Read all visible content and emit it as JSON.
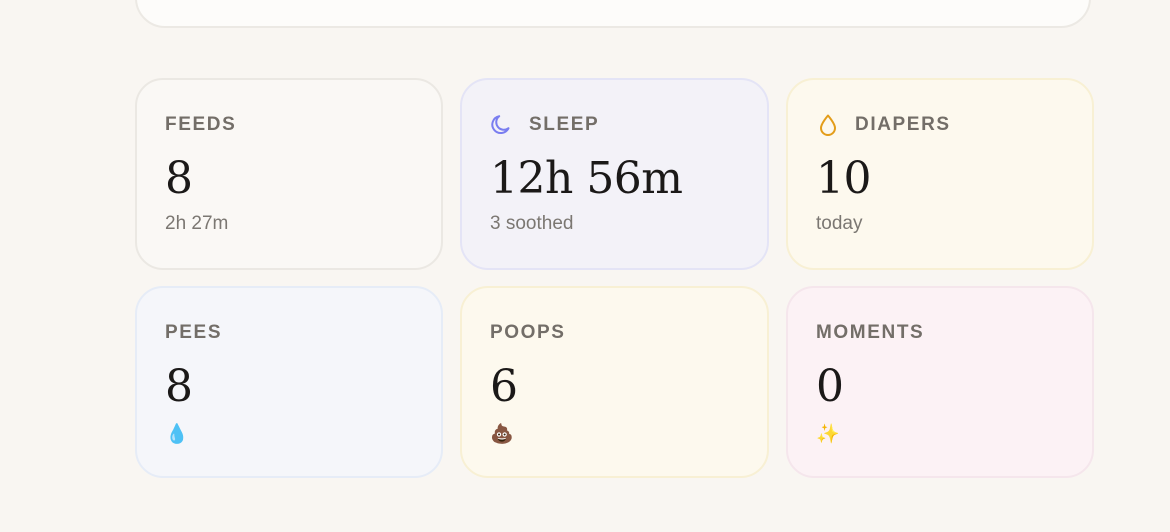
{
  "cards": {
    "feeds": {
      "label": "FEEDS",
      "value": "8",
      "sub": "2h 27m"
    },
    "sleep": {
      "label": "SLEEP",
      "value": "12h 56m",
      "sub": "3 soothed",
      "icon": "moon-icon",
      "icon_color": "#7a7ef0"
    },
    "diapers": {
      "label": "DIAPERS",
      "value": "10",
      "sub": "today",
      "icon": "drop-icon",
      "icon_color": "#e39d1a"
    },
    "pees": {
      "label": "PEES",
      "value": "8",
      "emoji": "💧"
    },
    "poops": {
      "label": "POOPS",
      "value": "6",
      "emoji": "💩"
    },
    "moments": {
      "label": "MOMENTS",
      "value": "0",
      "emoji": "✨"
    }
  }
}
